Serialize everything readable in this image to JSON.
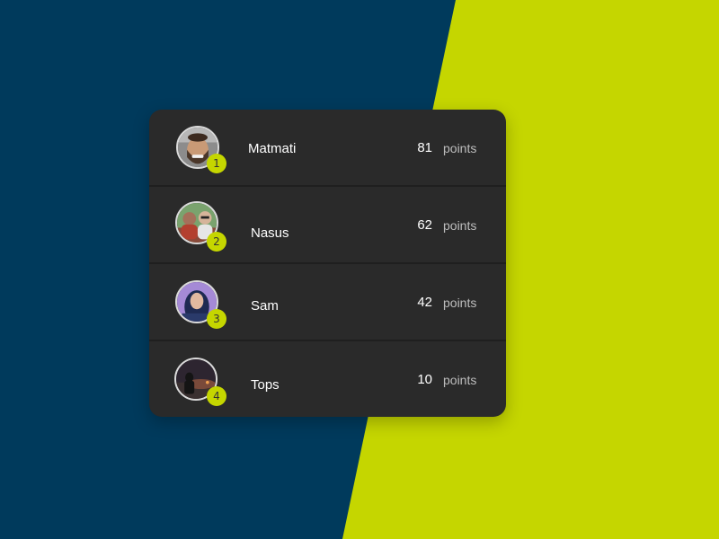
{
  "colors": {
    "background_dark": "#003a5c",
    "background_accent": "#c5d600",
    "card": "#2a2a2a",
    "badge": "#c5d600"
  },
  "leaderboard": [
    {
      "rank": "1",
      "name": "Matmati",
      "score": "81",
      "unit": "points",
      "avatar": "avatar-matmati"
    },
    {
      "rank": "2",
      "name": "Nasus",
      "score": "62",
      "unit": "points",
      "avatar": "avatar-nasus"
    },
    {
      "rank": "3",
      "name": "Sam",
      "score": "42",
      "unit": "points",
      "avatar": "avatar-sam"
    },
    {
      "rank": "4",
      "name": "Tops",
      "score": "10",
      "unit": "points",
      "avatar": "avatar-tops"
    }
  ]
}
